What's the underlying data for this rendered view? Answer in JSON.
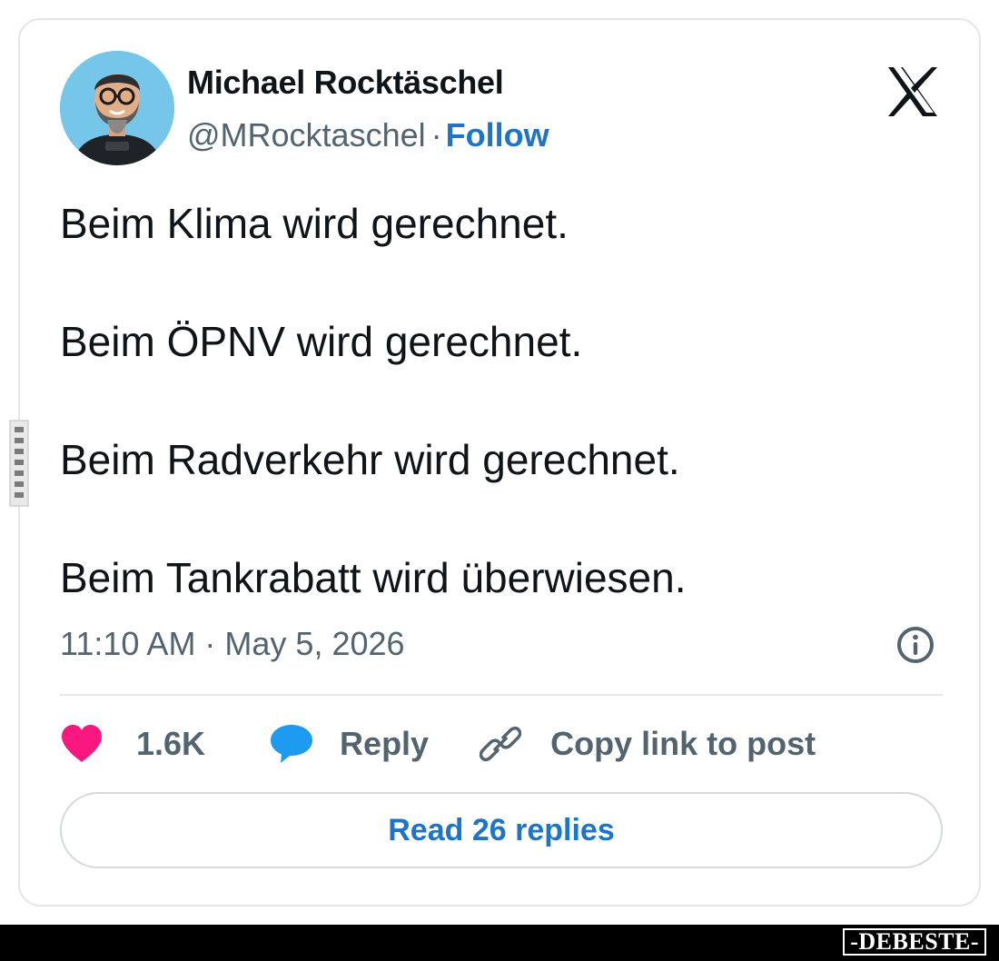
{
  "author": {
    "name": "Michael Rocktäschel",
    "handle": "@MRocktaschel",
    "separator": "·",
    "follow_label": "Follow"
  },
  "tweet": {
    "lines": [
      "Beim Klima wird gerechnet.",
      "Beim ÖPNV wird gerechnet.",
      "Beim Radverkehr wird gerechnet.",
      "Beim Tankrabatt wird überwiesen."
    ],
    "timestamp": "11:10 AM · May 5, 2026"
  },
  "actions": {
    "likes_count": "1.6K",
    "reply_label": "Reply",
    "copy_link_label": "Copy link to post"
  },
  "read_replies_label": "Read 26 replies",
  "watermark": {
    "side_text": "DEBESTE",
    "footer_text": "-DEBESTE-"
  },
  "icons": {
    "platform": "x-logo-icon",
    "info": "info-icon",
    "like": "heart-icon",
    "reply": "speech-bubble-icon",
    "copy_link": "link-icon"
  },
  "colors": {
    "link_blue": "#1d74c9",
    "heart_pink": "#f91880",
    "reply_blue": "#1d9bf0",
    "text_primary": "#0f1419",
    "text_secondary": "#536471",
    "avatar_bg": "#75c6e8"
  }
}
